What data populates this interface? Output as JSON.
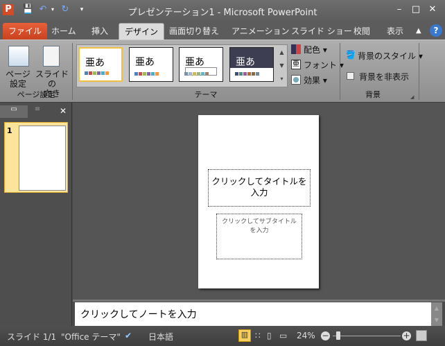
{
  "window": {
    "title": "プレゼンテーション1 - Microsoft PowerPoint"
  },
  "tabs": [
    "ファイル",
    "ホーム",
    "挿入",
    "デザイン",
    "画面切り替え",
    "アニメーション",
    "スライド ショー",
    "校閲",
    "表示"
  ],
  "ribbon": {
    "page_setup": {
      "page_setup_label": "ページ\n設定",
      "orientation_label": "スライドの\n向き",
      "group_label": "ページ設定"
    },
    "themes": {
      "group_label": "テーマ",
      "sample_text": "亜あ",
      "colors_label": "配色",
      "fonts_label": "フォント",
      "effects_label": "効果",
      "palettes": [
        [
          "#4f81bd",
          "#c0504d",
          "#9bbb59",
          "#8064a2",
          "#4bacc6",
          "#f79646"
        ],
        [
          "#4f81bd",
          "#c0504d",
          "#9bbb59",
          "#8064a2",
          "#4bacc6",
          "#f79646"
        ],
        [
          "#7d8fa8",
          "#a5b5c9",
          "#ceb966",
          "#9cb084",
          "#6bb1c9",
          "#9a7f73"
        ],
        [
          "#3e4f7a",
          "#4e8a88",
          "#a15ba0",
          "#b06c38",
          "#8a6a3a",
          "#6a8aa0"
        ]
      ]
    },
    "background": {
      "group_label": "背景",
      "styles_label": "背景のスタイル",
      "hide_label": "背景を非表示",
      "hide_checked": false
    }
  },
  "slides_panel": {
    "slide_number": "1"
  },
  "slide": {
    "title_placeholder": "クリックしてタイトルを入力",
    "subtitle_placeholder": "クリックしてサブタイトルを入力"
  },
  "notes": {
    "placeholder": "クリックしてノートを入力"
  },
  "status": {
    "slide": "スライド 1/1",
    "theme": "\"Office テーマ\"",
    "language": "日本語",
    "zoom": "24%",
    "zoom_value": 24
  },
  "colors": {
    "file_tab": "#d24a26",
    "accent": "#ffd75a"
  }
}
